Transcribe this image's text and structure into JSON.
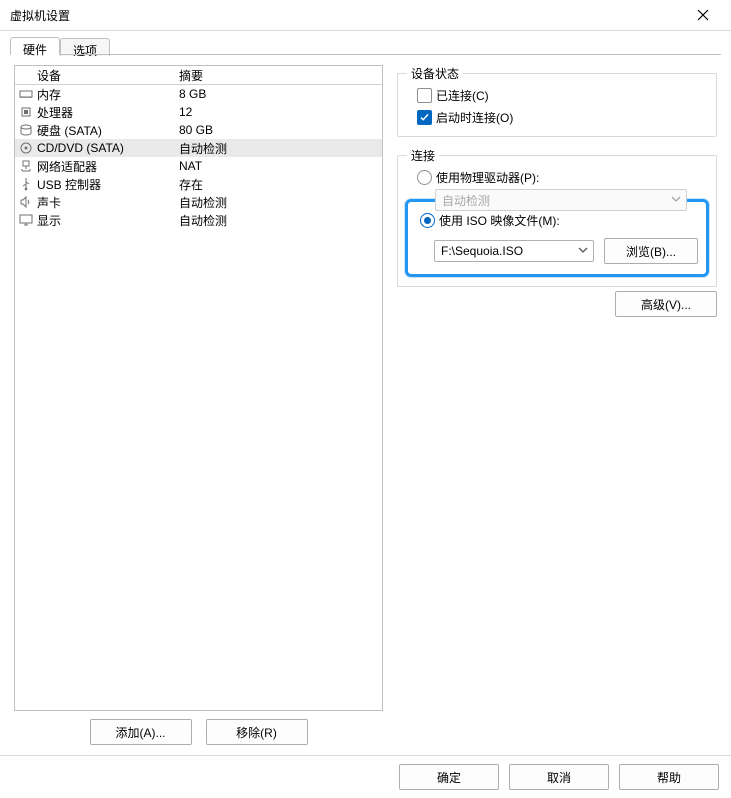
{
  "window": {
    "title": "虚拟机设置"
  },
  "tabs": {
    "hardware": "硬件",
    "options": "选项"
  },
  "headers": {
    "device": "设备",
    "summary": "摘要"
  },
  "devices": [
    {
      "icon": "memory-icon",
      "name": "内存",
      "summary": "8 GB",
      "selected": false
    },
    {
      "icon": "cpu-icon",
      "name": "处理器",
      "summary": "12",
      "selected": false
    },
    {
      "icon": "disk-icon",
      "name": "硬盘 (SATA)",
      "summary": "80 GB",
      "selected": false
    },
    {
      "icon": "disc-icon",
      "name": "CD/DVD (SATA)",
      "summary": "自动检测",
      "selected": true
    },
    {
      "icon": "network-icon",
      "name": "网络适配器",
      "summary": "NAT",
      "selected": false
    },
    {
      "icon": "usb-icon",
      "name": "USB 控制器",
      "summary": "存在",
      "selected": false
    },
    {
      "icon": "sound-icon",
      "name": "声卡",
      "summary": "自动检测",
      "selected": false
    },
    {
      "icon": "display-icon",
      "name": "显示",
      "summary": "自动检测",
      "selected": false
    }
  ],
  "left_buttons": {
    "add": "添加(A)...",
    "remove": "移除(R)"
  },
  "right": {
    "status_title": "设备状态",
    "connected": "已连接(C)",
    "connect_on_power": "启动时连接(O)",
    "connection_title": "连接",
    "use_physical": "使用物理驱动器(P):",
    "auto_detect": "自动检测",
    "use_iso": "使用 ISO 映像文件(M):",
    "iso_path": "F:\\Sequoia.ISO",
    "browse": "浏览(B)...",
    "advanced": "高级(V)..."
  },
  "footer": {
    "ok": "确定",
    "cancel": "取消",
    "help": "帮助"
  }
}
